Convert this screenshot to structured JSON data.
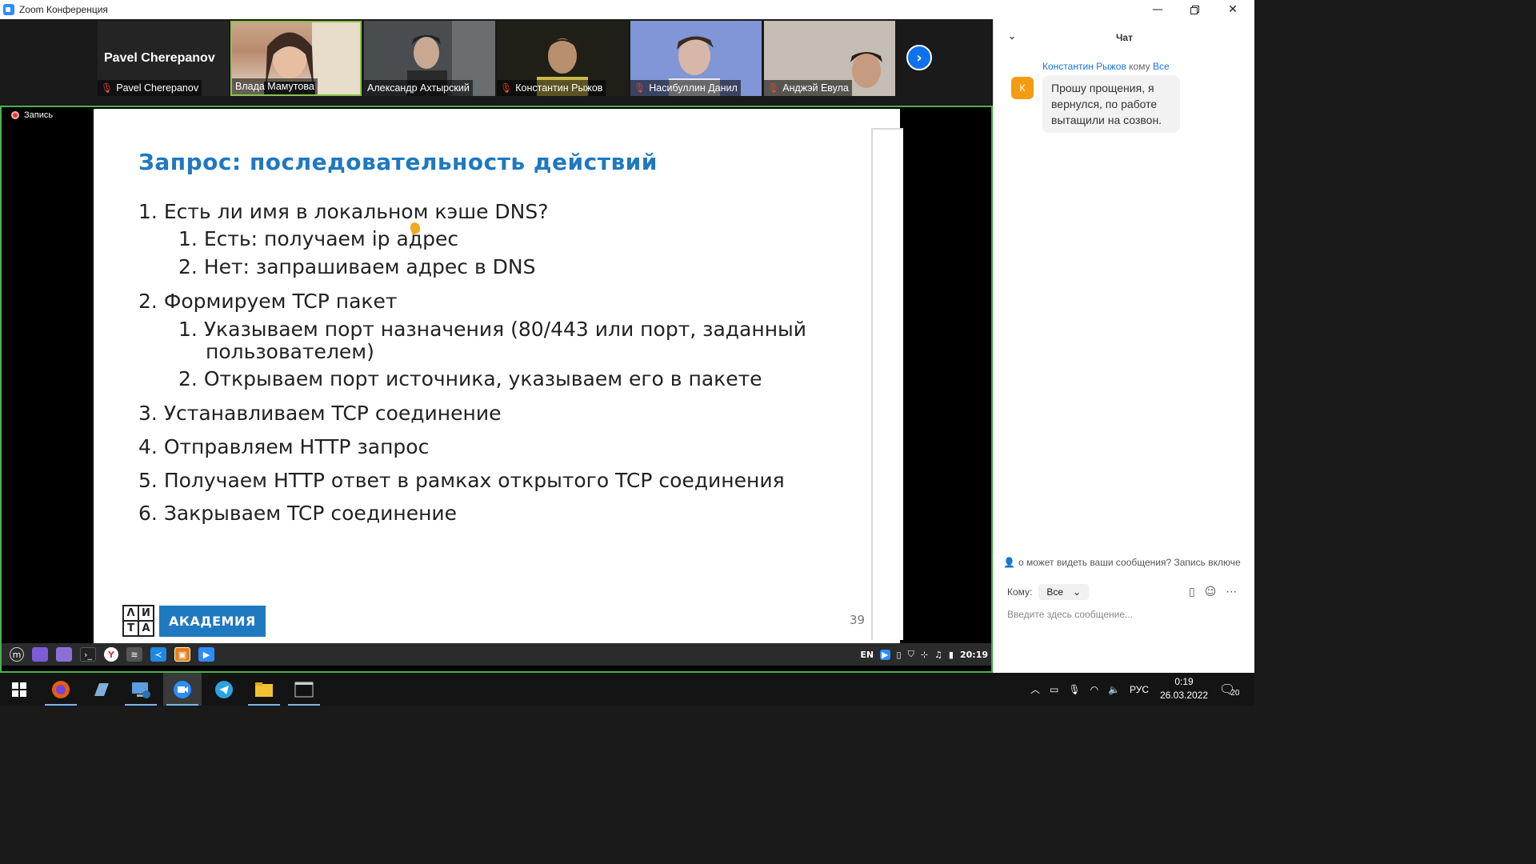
{
  "window": {
    "title": "Zoom Конференция"
  },
  "participants": {
    "active_name_big": "Pavel Cherepanov",
    "tiles": [
      {
        "name": "Pavel Cherepanov",
        "muted": true
      },
      {
        "name": "Влада Мамутова",
        "muted": false
      },
      {
        "name": "Александр Ахтырский",
        "muted": false
      },
      {
        "name": "Константин Рыжов",
        "muted": true
      },
      {
        "name": "Насибуллин Данил",
        "muted": true
      },
      {
        "name": "Анджэй Евула",
        "muted": true
      }
    ]
  },
  "share": {
    "recording_label": "Запись",
    "slide": {
      "title": "Запрос: последовательность действий",
      "items": [
        {
          "num": "1.",
          "text": "Есть ли имя в локальном кэше DNS?",
          "sub": [
            {
              "num": "1.",
              "text": "Есть: получаем ip адрес"
            },
            {
              "num": "2.",
              "text": "Нет: запрашиваем адрес в DNS"
            }
          ]
        },
        {
          "num": "2.",
          "text": "Формируем TCP пакет",
          "sub": [
            {
              "num": "1.",
              "text": "Указываем порт назначения (80/443 или порт, заданный пользователем)"
            },
            {
              "num": "2.",
              "text": "Открываем порт источника, указываем его в пакете"
            }
          ]
        },
        {
          "num": "3.",
          "text": "Устанавливаем TCP соединение"
        },
        {
          "num": "4.",
          "text": "Отправляем HTTP запрос"
        },
        {
          "num": "5.",
          "text": "Получаем HTTP ответ в рамках открытого TCP соединения"
        },
        {
          "num": "6.",
          "text": "Закрываем TCP соединение"
        }
      ],
      "page_number": "39",
      "logo_letters": [
        "Λ",
        "И",
        "Т",
        "А"
      ],
      "logo_word": "АКАДЕМИЯ"
    },
    "remote_taskbar": {
      "lang": "EN",
      "time": "20:19"
    }
  },
  "chat": {
    "header": "Чат",
    "messages": [
      {
        "sender": "Константин Рыжов",
        "to_word": "кому",
        "recipient": "Все",
        "avatar_letter": "К",
        "text": "Прошу прощения, я вернулся, по работе вытащили на созвон."
      }
    ],
    "notice": "о может видеть ваши сообщения? Запись включе",
    "to_label": "Кому:",
    "to_value": "Все",
    "input_placeholder": "Введите здесь сообщение..."
  },
  "taskbar": {
    "lang": "РУС",
    "time": "0:19",
    "date": "26.03.2022",
    "notifications": "20"
  },
  "colors": {
    "accent": "#1e79c1",
    "zoom_blue": "#0e72ed",
    "speaker_border": "#8bc34a"
  }
}
